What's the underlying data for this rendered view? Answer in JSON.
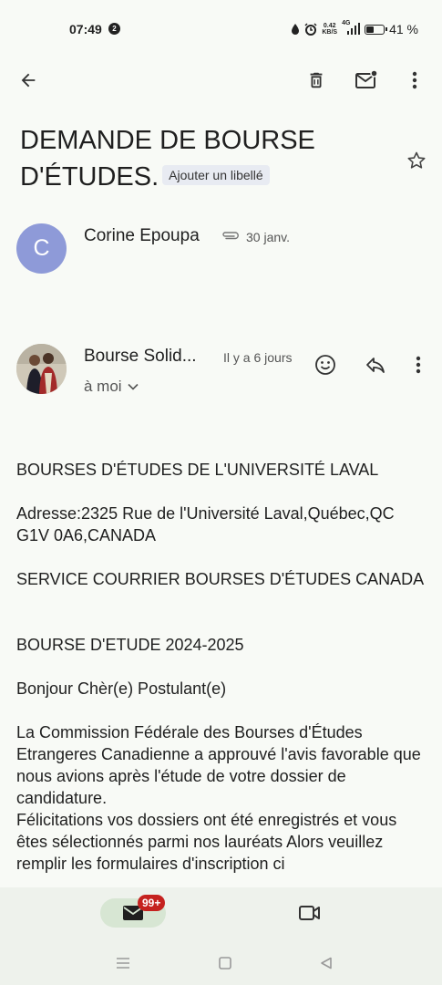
{
  "status_bar": {
    "time": "07:49",
    "notification_count": "2",
    "net_speed_value": "0.42",
    "net_speed_unit": "KB/S",
    "network_type": "4G",
    "battery_level": 0.41,
    "battery_percent": "41 %"
  },
  "toolbar": {
    "back_icon": "arrow-back-icon",
    "delete_icon": "trash-icon",
    "mark_unread_icon": "mail-unread-icon",
    "more_icon": "more-vert-icon"
  },
  "thread": {
    "subject": "DEMANDE DE BOURSE D'ÉTUDES.",
    "label_chip": "Ajouter un libellé"
  },
  "collapsed_message": {
    "avatar_letter": "C",
    "sender": "Corine Epoupa",
    "date": "30 janv."
  },
  "expanded_message": {
    "sender": "Bourse Solid...",
    "time_ago": "Il y a 6 jours",
    "recipient": "à moi",
    "body": [
      "BOURSES D'ÉTUDES DE L'UNIVERSITÉ LAVAL",
      "Adresse:2325 Rue de l'Université Laval,Québec,QC G1V 0A6,CANADA",
      "SERVICE COURRIER BOURSES D'ÉTUDES CANADA",
      "BOURSE D'ETUDE 2024-2025",
      "Bonjour Chèr(e) Postulant(e)",
      "La Commission Fédérale des Bourses d'Études Etrangeres Canadienne a approuvé l'avis favorable que nous avions après l'étude de votre dossier de candidature.",
      "Félicitations vos dossiers ont été enregistrés et vous êtes sélectionnés parmi nos lauréats Alors veuillez remplir les formulaires d'inscription ci"
    ]
  },
  "bottom_nav": {
    "mail_badge": "99+"
  },
  "colors": {
    "background": "#f8faf6",
    "avatar_c": "#8e9ad8",
    "badge": "#c5221f",
    "nav_active": "#d7e6d3"
  }
}
